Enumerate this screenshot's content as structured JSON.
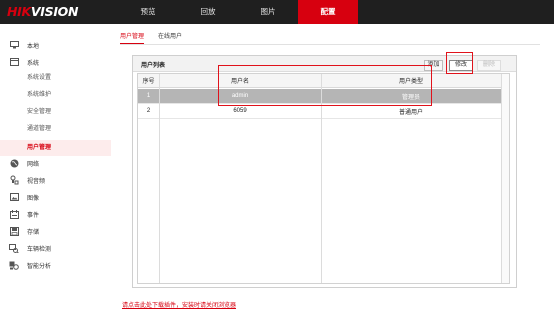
{
  "brand": {
    "logo_hik": "HIK",
    "logo_vision": "VISION",
    "accent_color": "#d7000f"
  },
  "top_nav": [
    {
      "label": "预览",
      "active": false
    },
    {
      "label": "回放",
      "active": false
    },
    {
      "label": "图片",
      "active": false
    },
    {
      "label": "配置",
      "active": true
    }
  ],
  "sidebar": {
    "items": [
      {
        "label": "本地",
        "icon": "monitor-icon"
      },
      {
        "label": "系统",
        "icon": "system-icon"
      },
      {
        "label": "网络",
        "icon": "globe-icon"
      },
      {
        "label": "视音频",
        "icon": "microphone-icon"
      },
      {
        "label": "图像",
        "icon": "image-icon"
      },
      {
        "label": "事件",
        "icon": "calendar-icon"
      },
      {
        "label": "存储",
        "icon": "save-icon"
      },
      {
        "label": "车辆检测",
        "icon": "car-detect-icon"
      },
      {
        "label": "智能分析",
        "icon": "smart-analysis-icon"
      }
    ],
    "system_sub": [
      "系统设置",
      "系统维护",
      "安全管理",
      "通道管理",
      "用户管理"
    ],
    "active_sub": "用户管理"
  },
  "tabs": [
    {
      "label": "用户管理",
      "active": true
    },
    {
      "label": "在线用户",
      "active": false
    }
  ],
  "user_list": {
    "title": "用户列表",
    "buttons": {
      "add": "添加",
      "edit": "修改",
      "delete": "删除"
    },
    "columns": [
      "序号",
      "用户名",
      "用户类型"
    ],
    "rows": [
      {
        "index": "1",
        "username": "admin",
        "type": "管理员",
        "selected": true
      },
      {
        "index": "2",
        "username": "6059",
        "type": "普通用户",
        "selected": false
      }
    ]
  },
  "footer": {
    "plugin_link": "请点击此处下载插件，安装时请关闭浏览器"
  }
}
